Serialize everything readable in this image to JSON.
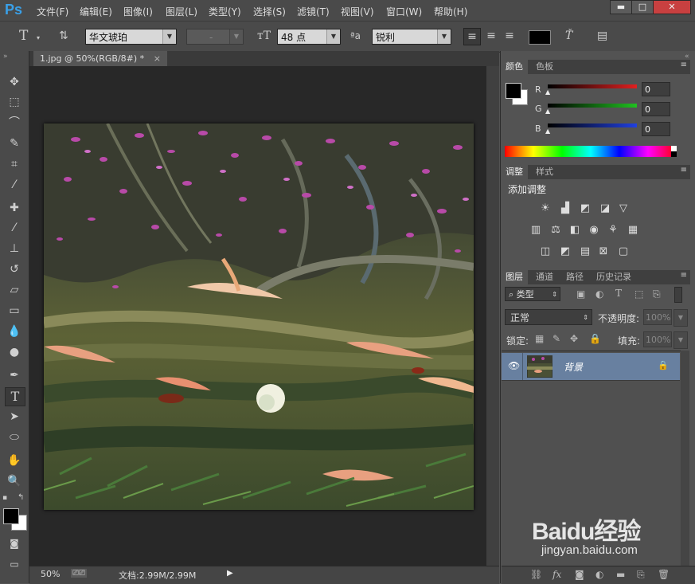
{
  "app": {
    "logo": "Ps"
  },
  "menu": [
    "文件(F)",
    "编辑(E)",
    "图像(I)",
    "图层(L)",
    "类型(Y)",
    "选择(S)",
    "滤镜(T)",
    "视图(V)",
    "窗口(W)",
    "帮助(H)"
  ],
  "window_buttons": [
    "▬",
    "□",
    "✕"
  ],
  "options": {
    "font_family": "华文琥珀",
    "font_style": "-",
    "font_size": "48 点",
    "aa_label": "ªa",
    "aa_mode": "锐利"
  },
  "document": {
    "tab_title": "1.jpg @ 50%(RGB/8#) *",
    "close": "×"
  },
  "status": {
    "zoom": "50%",
    "doc_info": "文档:2.99M/2.99M"
  },
  "color_panel": {
    "tabs": [
      "颜色",
      "色板"
    ],
    "channels": [
      {
        "label": "R",
        "value": "0",
        "color": "#e02020"
      },
      {
        "label": "G",
        "value": "0",
        "color": "#20c020"
      },
      {
        "label": "B",
        "value": "0",
        "color": "#2040e0"
      }
    ]
  },
  "adjust_panel": {
    "tabs": [
      "调整",
      "样式"
    ],
    "title": "添加调整"
  },
  "layers_panel": {
    "tabs": [
      "图层",
      "通道",
      "路径",
      "历史记录"
    ],
    "filter_kind": "类型",
    "blend_mode": "正常",
    "opacity_label": "不透明度:",
    "opacity_value": "100%",
    "lock_label": "锁定:",
    "fill_label": "填充:",
    "fill_value": "100%",
    "layers": [
      {
        "name": "背景",
        "visible": true,
        "locked": true
      }
    ]
  },
  "watermark": {
    "brand": "Baidu经验",
    "url": "jingyan.baidu.com"
  }
}
